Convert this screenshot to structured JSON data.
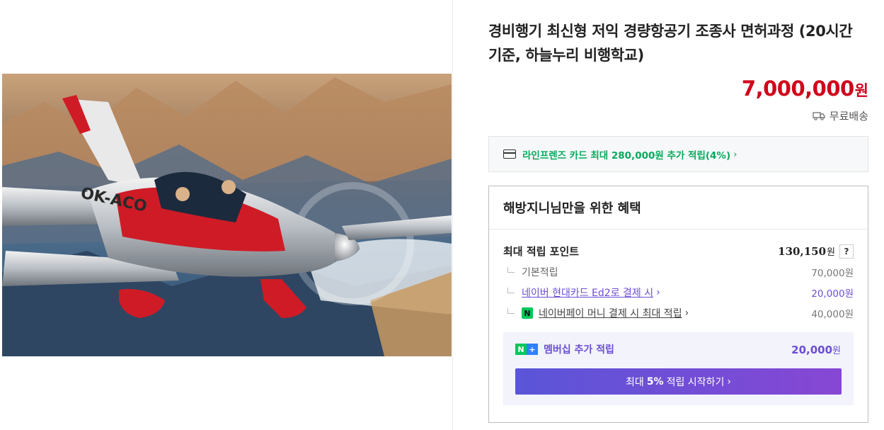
{
  "product": {
    "title": "경비행기 최신형 저익 경량항공기 조종사 면허과정 (20시간 기준, 하늘누리 비행학교)",
    "price": "7,000,000",
    "price_unit": "원",
    "shipping": "무료배송",
    "image_alt": "red and silver light aircraft flying over mountains"
  },
  "card_benefit": {
    "label": "라인프렌즈 카드 최대 280,000원 추가 적립(4%)",
    "icon": "credit-card-icon"
  },
  "benefits": {
    "heading": "해방지니님만을 위한 혜택",
    "max_points_label": "최대 적립 포인트",
    "max_points_value": "130,150",
    "unit": "원",
    "help": "?",
    "items": [
      {
        "label": "기본적립",
        "value": "70,000원"
      },
      {
        "label": "네이버 현대카드 Ed2로 결제 시",
        "value": "20,000원"
      },
      {
        "label": "네이버페이 머니 결제 시 최대 적립",
        "value": "40,000원"
      }
    ],
    "membership": {
      "label": "멤버십 추가 적립",
      "value": "20,000",
      "unit": "원",
      "cta_pre": "최대",
      "cta_bold": "5%",
      "cta_post": "적립 시작하기"
    }
  },
  "colors": {
    "price": "#d0021b",
    "naver_green": "#03c75a",
    "membership_purple": "#6c4dd6"
  }
}
